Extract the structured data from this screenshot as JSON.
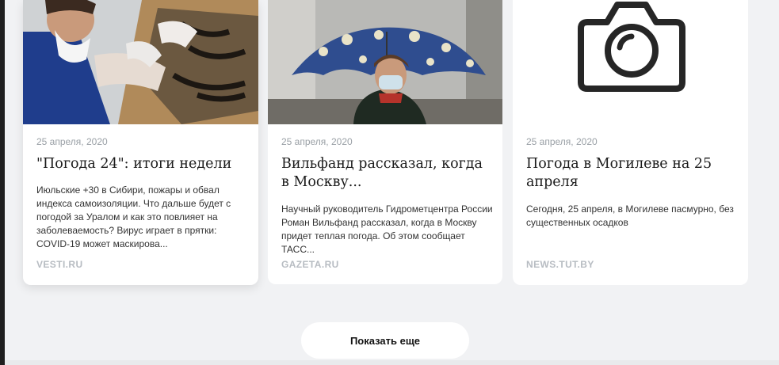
{
  "cards": [
    {
      "date": "25 апреля, 2020",
      "title": "\"Погода 24\": итоги недели",
      "excerpt": "Июльские +30 в Сибири, пожары и обвал индекса самоизоляции. Что дальше будет с погодой за Уралом и как это повлияет на заболеваемость? Вирус играет в прятки: COVID-19 может маскирова...",
      "source": "VESTI.RU"
    },
    {
      "date": "25 апреля, 2020",
      "title": "Вильфанд рассказал, когда в Москву...",
      "excerpt": "Научный руководитель Гидрометцентра России Роман Вильфанд рассказал, когда в Москву придет теплая погода. Об этом сообщает ТАСС...",
      "source": "GAZETA.RU"
    },
    {
      "date": "25 апреля, 2020",
      "title": "Погода в Могилеве на 25 апреля",
      "excerpt": "Сегодня, 25 апреля, в Могилеве пасмурно, без существенных осадков",
      "source": "NEWS.TUT.BY"
    }
  ],
  "show_more_label": "Показать еще",
  "card3_icon": "camera-icon"
}
